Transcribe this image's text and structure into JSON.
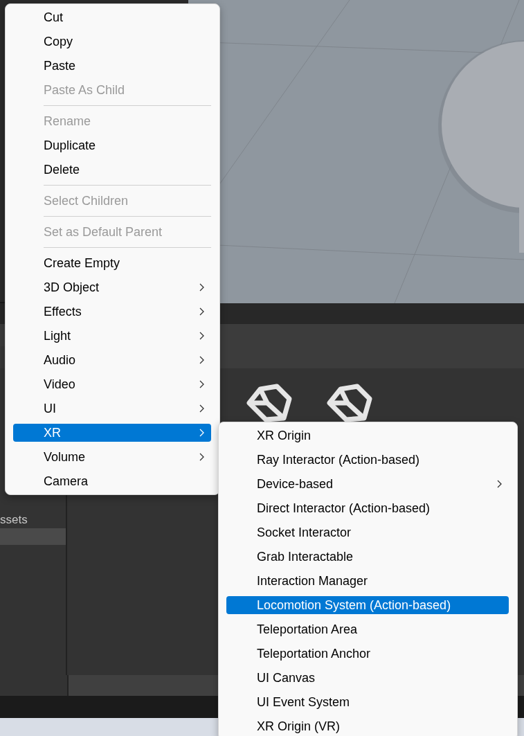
{
  "project_panel": {
    "folder_label": "ssets"
  },
  "context_menu": {
    "groups": [
      [
        {
          "label": "Cut",
          "disabled": false,
          "has_submenu": false,
          "selected": false
        },
        {
          "label": "Copy",
          "disabled": false,
          "has_submenu": false,
          "selected": false
        },
        {
          "label": "Paste",
          "disabled": false,
          "has_submenu": false,
          "selected": false
        },
        {
          "label": "Paste As Child",
          "disabled": true,
          "has_submenu": false,
          "selected": false
        }
      ],
      [
        {
          "label": "Rename",
          "disabled": true,
          "has_submenu": false,
          "selected": false
        },
        {
          "label": "Duplicate",
          "disabled": false,
          "has_submenu": false,
          "selected": false
        },
        {
          "label": "Delete",
          "disabled": false,
          "has_submenu": false,
          "selected": false
        }
      ],
      [
        {
          "label": "Select Children",
          "disabled": true,
          "has_submenu": false,
          "selected": false
        }
      ],
      [
        {
          "label": "Set as Default Parent",
          "disabled": true,
          "has_submenu": false,
          "selected": false
        }
      ],
      [
        {
          "label": "Create Empty",
          "disabled": false,
          "has_submenu": false,
          "selected": false
        },
        {
          "label": "3D Object",
          "disabled": false,
          "has_submenu": true,
          "selected": false
        },
        {
          "label": "Effects",
          "disabled": false,
          "has_submenu": true,
          "selected": false
        },
        {
          "label": "Light",
          "disabled": false,
          "has_submenu": true,
          "selected": false
        },
        {
          "label": "Audio",
          "disabled": false,
          "has_submenu": true,
          "selected": false
        },
        {
          "label": "Video",
          "disabled": false,
          "has_submenu": true,
          "selected": false
        },
        {
          "label": "UI",
          "disabled": false,
          "has_submenu": true,
          "selected": false
        },
        {
          "label": "XR",
          "disabled": false,
          "has_submenu": true,
          "selected": true
        },
        {
          "label": "Volume",
          "disabled": false,
          "has_submenu": true,
          "selected": false
        },
        {
          "label": "Camera",
          "disabled": false,
          "has_submenu": false,
          "selected": false
        }
      ]
    ]
  },
  "submenu": {
    "groups": [
      [
        {
          "label": "XR Origin",
          "disabled": false,
          "has_submenu": false,
          "selected": false
        },
        {
          "label": "Ray Interactor (Action-based)",
          "disabled": false,
          "has_submenu": false,
          "selected": false
        },
        {
          "label": "Device-based",
          "disabled": false,
          "has_submenu": true,
          "selected": false
        },
        {
          "label": "Direct Interactor (Action-based)",
          "disabled": false,
          "has_submenu": false,
          "selected": false
        },
        {
          "label": "Socket Interactor",
          "disabled": false,
          "has_submenu": false,
          "selected": false
        },
        {
          "label": "Grab Interactable",
          "disabled": false,
          "has_submenu": false,
          "selected": false
        },
        {
          "label": "Interaction Manager",
          "disabled": false,
          "has_submenu": false,
          "selected": false
        },
        {
          "label": "Locomotion System (Action-based)",
          "disabled": false,
          "has_submenu": false,
          "selected": true
        },
        {
          "label": "Teleportation Area",
          "disabled": false,
          "has_submenu": false,
          "selected": false
        },
        {
          "label": "Teleportation Anchor",
          "disabled": false,
          "has_submenu": false,
          "selected": false
        },
        {
          "label": "UI Canvas",
          "disabled": false,
          "has_submenu": false,
          "selected": false
        },
        {
          "label": "UI Event System",
          "disabled": false,
          "has_submenu": false,
          "selected": false
        },
        {
          "label": "XR Origin (VR)",
          "disabled": false,
          "has_submenu": false,
          "selected": false
        }
      ]
    ]
  }
}
